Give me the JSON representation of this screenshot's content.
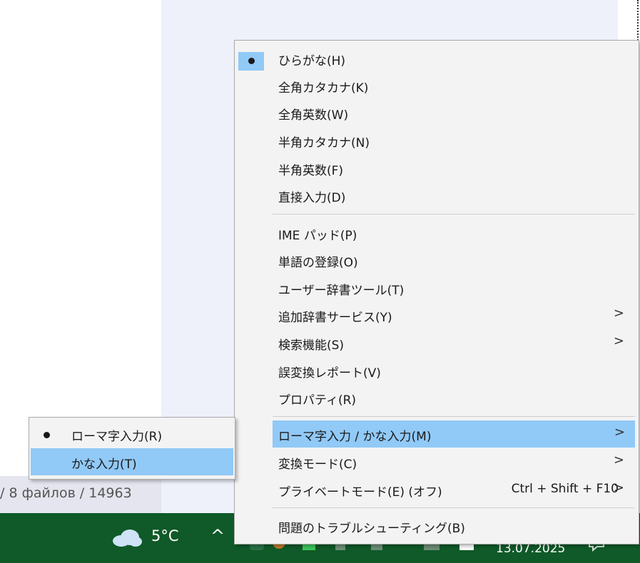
{
  "background": {
    "status_text": "/ 8 файлов / 14963"
  },
  "taskbar": {
    "weather_icon": "cloud-icon",
    "temperature": "5°C",
    "overflow_chevron": "^",
    "date": "13.07.2025"
  },
  "ime_menu": {
    "input_modes": [
      {
        "label": "ひらがな(H)",
        "checked": true
      },
      {
        "label": "全角カタカナ(K)"
      },
      {
        "label": "全角英数(W)"
      },
      {
        "label": "半角カタカナ(N)"
      },
      {
        "label": "半角英数(F)"
      },
      {
        "label": "直接入力(D)"
      }
    ],
    "tools": [
      {
        "label": "IME パッド(P)"
      },
      {
        "label": "単語の登録(O)"
      },
      {
        "label": "ユーザー辞書ツール(T)"
      },
      {
        "label": "追加辞書サービス(Y)",
        "submenu": true
      },
      {
        "label": "検索機能(S)",
        "submenu": true
      },
      {
        "label": "誤変換レポート(V)"
      },
      {
        "label": "プロパティ(R)"
      }
    ],
    "modes": [
      {
        "label": "ローマ字入力 / かな入力(M)",
        "submenu": true,
        "highlighted": true
      },
      {
        "label": "変換モード(C)",
        "submenu": true
      },
      {
        "label": "プライベートモード(E) (オフ)",
        "shortcut": "Ctrl + Shift + F10",
        "submenu": true
      }
    ],
    "troubleshoot": {
      "label": "問題のトラブルシューティング(B)"
    },
    "submenu_arrow": ">"
  },
  "romaji_submenu": {
    "items": [
      {
        "label": "ローマ字入力(R)",
        "checked": true
      },
      {
        "label": "かな入力(T)",
        "highlighted": true
      }
    ]
  },
  "colors": {
    "highlight": "#91c9f7",
    "menu_bg": "#f3f3f3",
    "taskbar": "#0f5a28"
  }
}
